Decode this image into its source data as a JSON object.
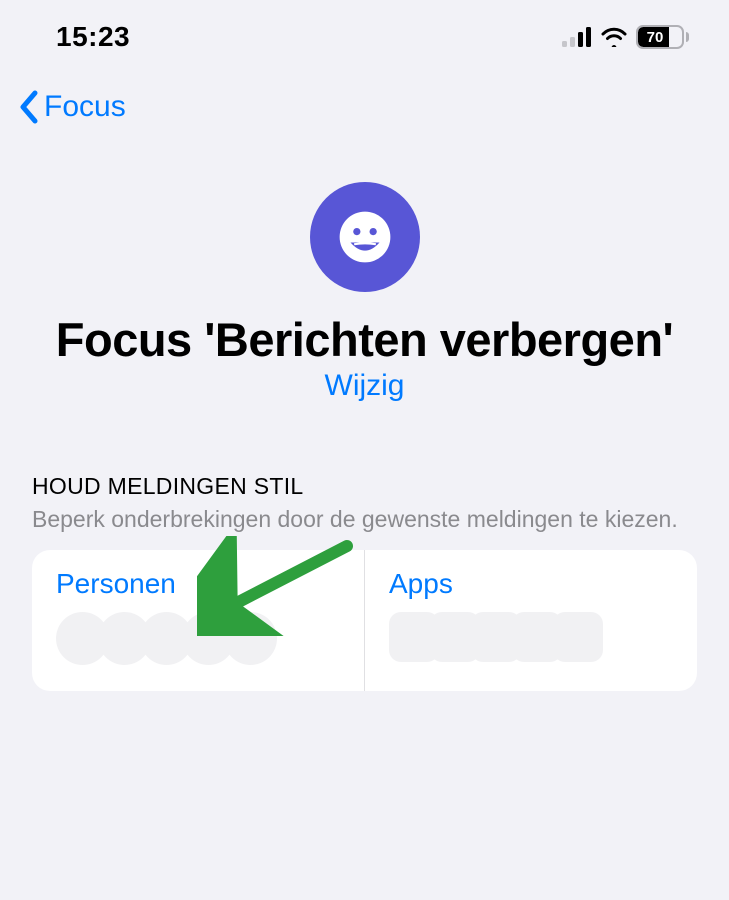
{
  "status": {
    "time": "15:23",
    "battery": "70"
  },
  "nav": {
    "back_label": "Focus"
  },
  "header": {
    "title": "Focus 'Berichten verbergen'",
    "edit_label": "Wijzig"
  },
  "section": {
    "heading": "HOUD MELDINGEN STIL",
    "subtext": "Beperk onderbrekingen door de gewenste meldingen te kiezen."
  },
  "cards": {
    "people_label": "Personen",
    "apps_label": "Apps"
  },
  "colors": {
    "accent": "#007aff",
    "focus_circle": "#5856d6",
    "arrow": "#2e9f3d"
  }
}
